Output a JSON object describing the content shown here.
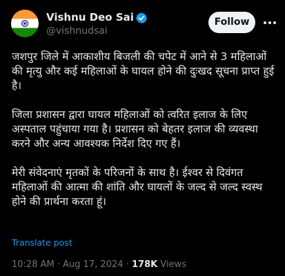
{
  "author": {
    "display_name": "Vishnu Deo Sai",
    "handle": "@vishnudsai",
    "verified": true,
    "avatar_icon": "indian-flag-icon"
  },
  "header": {
    "follow_label": "Follow",
    "more_icon": "more-horizontal-icon"
  },
  "tweet": {
    "paragraphs": [
      "जशपुर जिले में आकाशीय बिजली की चपेट में आने से 3 महिलाओं की मृत्यु और कई महिलाओं के घायल होने की दुःखद सूचना प्राप्त हुई है।",
      "जिला प्रशासन द्वारा घायल महिलाओं को त्वरित इलाज के लिए अस्पताल पहुंचाया गया है। प्रशासन को बेहतर इलाज की व्यवस्था करने और अन्य आवश्यक निर्देश दिए गए हैं।",
      "मेरी संवेदनाएं मृतकों के परिजनों के साथ है। ईश्वर से दिवंगत महिलाओं की आत्मा की शांति और घायलों के जल्द से जल्द स्वस्थ होने की प्रार्थना करता हूं।"
    ],
    "translate_label": "Translate post",
    "time": "10:28 AM",
    "separator": "·",
    "date": "Aug 17, 2024",
    "views_count": "178K",
    "views_label": "Views"
  },
  "colors": {
    "background": "#000000",
    "text": "#e7e9ea",
    "secondary_text": "#71767b",
    "link": "#1d9bf0",
    "verified_badge": "#1d9bf0",
    "follow_bg": "#eff3f4",
    "flag_saffron": "#ff9933",
    "flag_green": "#138808",
    "flag_chakra": "#000080"
  }
}
